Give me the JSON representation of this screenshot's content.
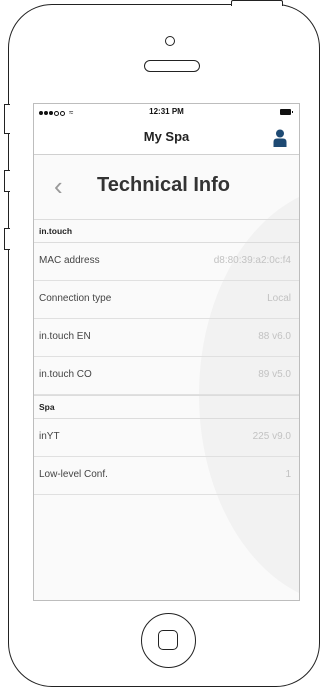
{
  "status": {
    "time": "12:31 PM",
    "wifi_glyph": "≈"
  },
  "nav": {
    "title": "My Spa",
    "user_icon": "person-icon",
    "accent": "#1e4a73"
  },
  "page": {
    "back_glyph": "‹",
    "title": "Technical Info"
  },
  "sections": [
    {
      "title": "in.touch",
      "rows": [
        {
          "label": "MAC address",
          "value": "d8:80:39:a2:0c:f4"
        },
        {
          "label": "Connection type",
          "value": "Local"
        },
        {
          "label": "in.touch EN",
          "value": "88 v6.0"
        },
        {
          "label": "in.touch CO",
          "value": "89 v5.0"
        }
      ]
    },
    {
      "title": "Spa",
      "rows": [
        {
          "label": "inYT",
          "value": "225 v9.0"
        },
        {
          "label": "Low-level Conf.",
          "value": "1"
        }
      ]
    }
  ]
}
